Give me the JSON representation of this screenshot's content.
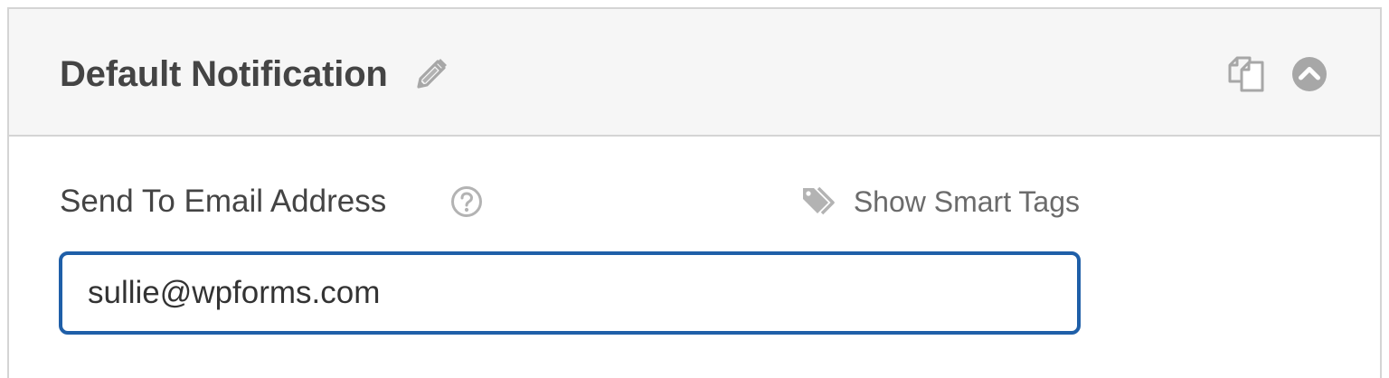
{
  "header": {
    "title": "Default Notification",
    "edit_icon": "pencil-icon",
    "duplicate_icon": "duplicate-icon",
    "collapse_icon": "chevron-up-circle-icon"
  },
  "field": {
    "label": "Send To Email Address",
    "help_icon": "question-circle-icon",
    "smart_tags_label": "Show Smart Tags",
    "smart_tags_icon": "tags-icon",
    "value": "sullie@wpforms.com"
  },
  "colors": {
    "header_bg": "#f6f6f6",
    "border": "#d4d4d4",
    "input_focus_border": "#1f5fa8",
    "text": "#444444",
    "icon": "#a7a7a7"
  }
}
